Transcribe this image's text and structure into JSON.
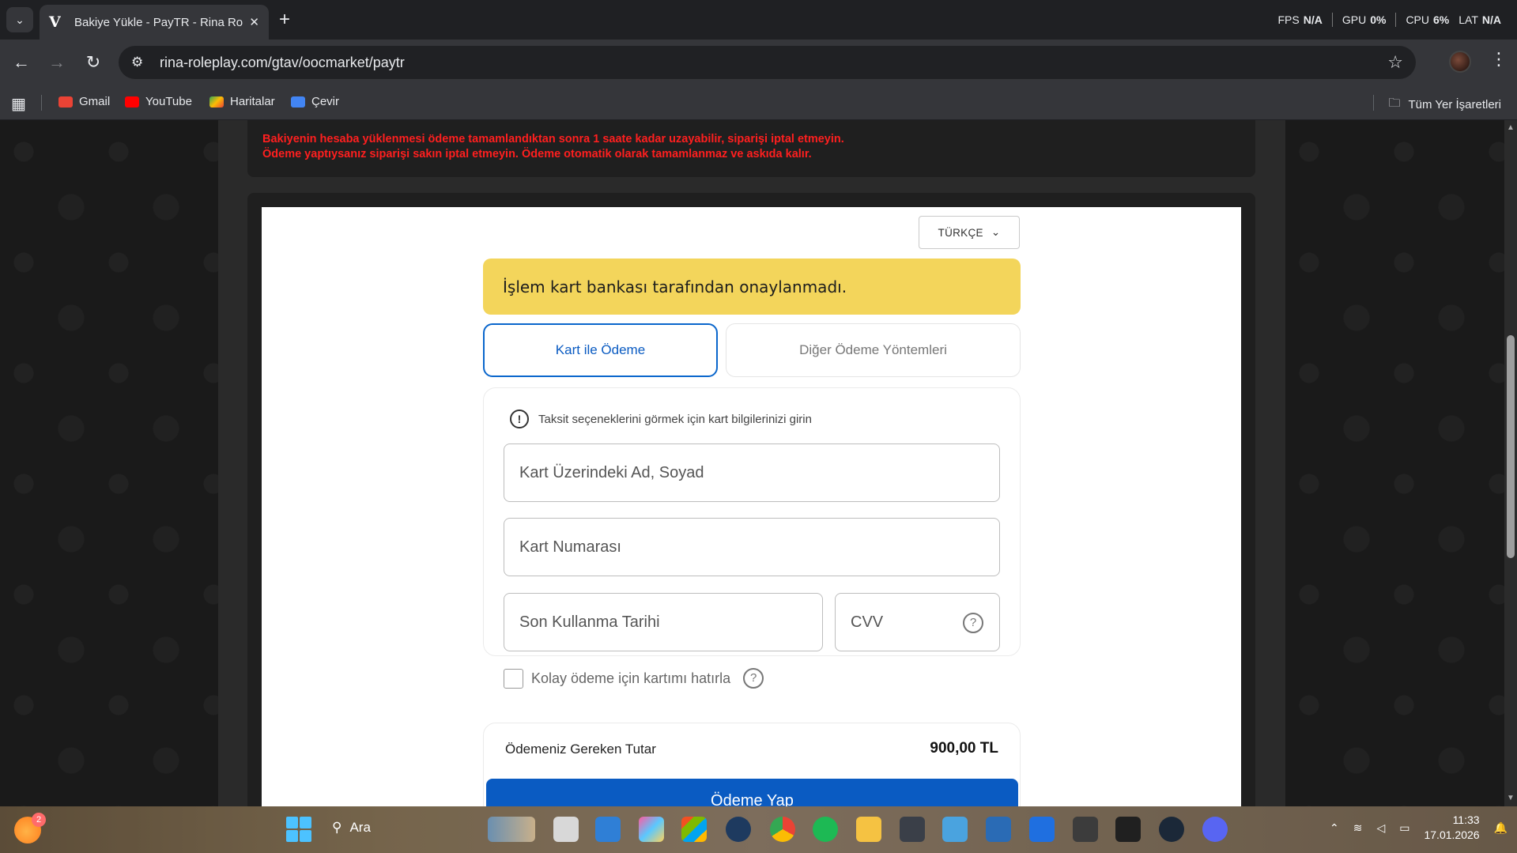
{
  "browser": {
    "tab_title": "Bakiye Yükle - PayTR - Rina Rol",
    "tab_favicon": "V",
    "url": "rina-roleplay.com/gtav/oocmarket/paytr",
    "perf": {
      "fps_label": "FPS",
      "fps_value": "N/A",
      "gpu_label": "GPU",
      "gpu_value": "0%",
      "cpu_label": "CPU",
      "cpu_value": "6%",
      "lat_label": "LAT",
      "lat_value": "N/A"
    }
  },
  "bookmarks": {
    "items": [
      {
        "label": "Gmail",
        "color": "#ea4335"
      },
      {
        "label": "YouTube",
        "color": "#ff0000"
      },
      {
        "label": "Haritalar",
        "color": "#34a853"
      },
      {
        "label": "Çevir",
        "color": "#4285f4"
      }
    ],
    "all_label": "Tüm Yer İşaretleri"
  },
  "page": {
    "alert_line1": "Bakiyenin hesaba yüklenmesi ödeme tamamlandıktan sonra 1 saate kadar uzayabilir, siparişi iptal etmeyin.",
    "alert_line2": "Ödeme yaptıysanız siparişi sakın iptal etmeyin. Ödeme otomatik olarak tamamlanmaz ve askıda kalır.",
    "alert_color": "#ff1f1f"
  },
  "paytr": {
    "language": "TÜRKÇE",
    "warning": "İşlem kart bankası tarafından onaylanmadı.",
    "tab_card": "Kart ile Ödeme",
    "tab_other": "Diğer Ödeme Yöntemleri",
    "info": "Taksit seçeneklerini görmek için kart bilgilerinizi girin",
    "fields": {
      "name_placeholder": "Kart Üzerindeki Ad, Soyad",
      "number_placeholder": "Kart Numarası",
      "expiry_placeholder": "Son Kullanma Tarihi",
      "cvv_placeholder": "CVV"
    },
    "remember_label": "Kolay ödeme için kartımı hatırla",
    "remember_checked": false,
    "amount_label": "Ödemeniz Gereken Tutar",
    "amount_value": "900,00 TL",
    "pay_button": "Ödeme Yap",
    "accent_color": "#0a5bc2",
    "warning_color": "#f3d55b"
  },
  "taskbar": {
    "search_label": "Ara",
    "notification_count": "2",
    "time": "11:33",
    "date": "17.01.2026"
  }
}
